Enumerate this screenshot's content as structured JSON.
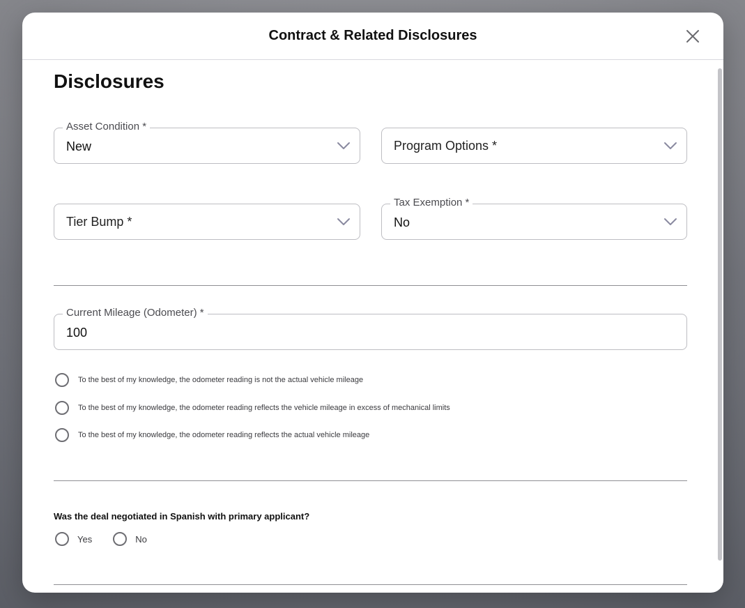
{
  "modal": {
    "title": "Contract & Related Disclosures"
  },
  "section": {
    "title": "Disclosures"
  },
  "fields": {
    "asset_condition": {
      "label": "Asset Condition *",
      "value": "New"
    },
    "program_options": {
      "placeholder": "Program Options *"
    },
    "tier_bump": {
      "placeholder": "Tier Bump *"
    },
    "tax_exemption": {
      "label": "Tax Exemption *",
      "value": "No"
    },
    "current_mileage": {
      "label": "Current Mileage (Odometer) *",
      "value": "100"
    }
  },
  "odometer_options": [
    "To the best of my knowledge, the odometer reading is not the actual vehicle mileage",
    "To the best of my knowledge, the odometer reading reflects the vehicle mileage in excess of mechanical limits",
    "To the best of my knowledge, the odometer reading reflects the actual vehicle mileage"
  ],
  "spanish_question": {
    "text": "Was the deal negotiated in Spanish with primary applicant?",
    "options": [
      "Yes",
      "No"
    ]
  },
  "icons": {
    "close": "close-icon",
    "dropdown": "chevron-down-icon"
  }
}
